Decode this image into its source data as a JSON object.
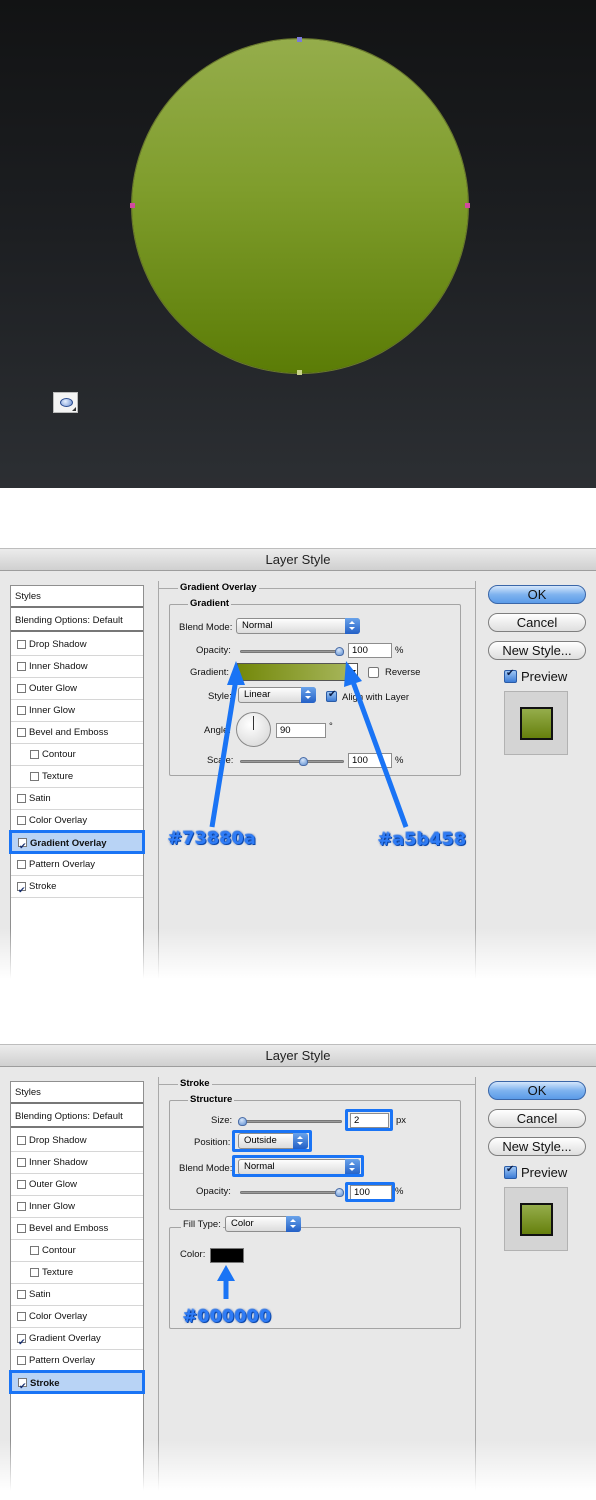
{
  "canvas": {
    "layer_icon": "shape-layer-icon"
  },
  "dialog1": {
    "title": "Layer Style",
    "styles_list": [
      {
        "label": "Styles"
      },
      {
        "label": "Blending Options: Default"
      },
      {
        "label": "Drop Shadow",
        "checked": false
      },
      {
        "label": "Inner Shadow",
        "checked": false
      },
      {
        "label": "Outer Glow",
        "checked": false
      },
      {
        "label": "Inner Glow",
        "checked": false
      },
      {
        "label": "Bevel and Emboss",
        "checked": false
      },
      {
        "label": "Contour",
        "checked": false
      },
      {
        "label": "Texture",
        "checked": false
      },
      {
        "label": "Satin",
        "checked": false
      },
      {
        "label": "Color Overlay",
        "checked": false
      },
      {
        "label": "Gradient Overlay",
        "checked": true,
        "selected": true
      },
      {
        "label": "Pattern Overlay",
        "checked": false
      },
      {
        "label": "Stroke",
        "checked": true
      }
    ],
    "section_title": "Gradient Overlay",
    "group_title": "Gradient",
    "blend_mode_label": "Blend Mode:",
    "blend_mode_value": "Normal",
    "opacity_label": "Opacity:",
    "opacity_value": "100",
    "opacity_unit": "%",
    "gradient_label": "Gradient:",
    "gradient_colors": [
      "#73880a",
      "#a5b458"
    ],
    "reverse_label": "Reverse",
    "style_label": "Style:",
    "style_value": "Linear",
    "align_label": "Align with Layer",
    "angle_label": "Angle:",
    "angle_value": "90",
    "angle_unit": "°",
    "scale_label": "Scale:",
    "scale_value": "100",
    "scale_unit": "%",
    "callout_left": "#73880a",
    "callout_right": "#a5b458",
    "buttons": {
      "ok": "OK",
      "cancel": "Cancel",
      "new_style": "New Style...",
      "preview": "Preview"
    }
  },
  "dialog2": {
    "title": "Layer Style",
    "styles_list": [
      {
        "label": "Styles"
      },
      {
        "label": "Blending Options: Default"
      },
      {
        "label": "Drop Shadow",
        "checked": false
      },
      {
        "label": "Inner Shadow",
        "checked": false
      },
      {
        "label": "Outer Glow",
        "checked": false
      },
      {
        "label": "Inner Glow",
        "checked": false
      },
      {
        "label": "Bevel and Emboss",
        "checked": false
      },
      {
        "label": "Contour",
        "checked": false
      },
      {
        "label": "Texture",
        "checked": false
      },
      {
        "label": "Satin",
        "checked": false
      },
      {
        "label": "Color Overlay",
        "checked": false
      },
      {
        "label": "Gradient Overlay",
        "checked": true
      },
      {
        "label": "Pattern Overlay",
        "checked": false
      },
      {
        "label": "Stroke",
        "checked": true,
        "selected": true
      }
    ],
    "section_title": "Stroke",
    "group_title": "Structure",
    "size_label": "Size:",
    "size_value": "2",
    "size_unit": "px",
    "position_label": "Position:",
    "position_value": "Outside",
    "blend_mode_label": "Blend Mode:",
    "blend_mode_value": "Normal",
    "opacity_label": "Opacity:",
    "opacity_value": "100",
    "opacity_unit": "%",
    "fill_type_label": "Fill Type:",
    "fill_type_value": "Color",
    "color_label": "Color:",
    "color_value": "#000000",
    "callout_color": "#000000",
    "buttons": {
      "ok": "OK",
      "cancel": "Cancel",
      "new_style": "New Style...",
      "preview": "Preview"
    }
  },
  "colors": {
    "accent_blue": "#1a74f5",
    "circle_top": "#95ad4b",
    "circle_bottom": "#5b7c06"
  }
}
